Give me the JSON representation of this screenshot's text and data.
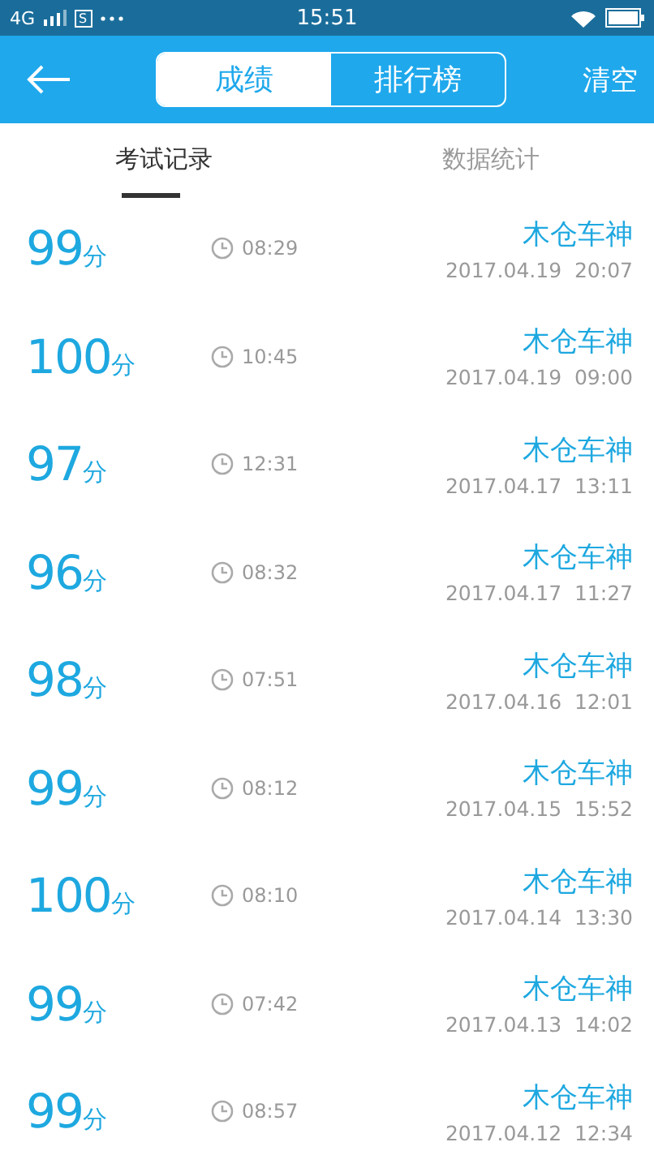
{
  "status_bar": {
    "network": "4G",
    "notification": "S",
    "time": "15:51"
  },
  "header": {
    "tabs": [
      {
        "label": "成绩",
        "selected": true
      },
      {
        "label": "排行榜",
        "selected": false
      }
    ],
    "action": "清空"
  },
  "sub_tabs": [
    {
      "label": "考试记录",
      "selected": true
    },
    {
      "label": "数据统计",
      "selected": false
    }
  ],
  "records": [
    {
      "score": "99",
      "unit": "分",
      "duration": "08:29",
      "name": "木仓车神",
      "date": "2017.04.19  20:07"
    },
    {
      "score": "100",
      "unit": "分",
      "duration": "10:45",
      "name": "木仓车神",
      "date": "2017.04.19  09:00"
    },
    {
      "score": "97",
      "unit": "分",
      "duration": "12:31",
      "name": "木仓车神",
      "date": "2017.04.17  13:11"
    },
    {
      "score": "96",
      "unit": "分",
      "duration": "08:32",
      "name": "木仓车神",
      "date": "2017.04.17  11:27"
    },
    {
      "score": "98",
      "unit": "分",
      "duration": "07:51",
      "name": "木仓车神",
      "date": "2017.04.16  12:01"
    },
    {
      "score": "99",
      "unit": "分",
      "duration": "08:12",
      "name": "木仓车神",
      "date": "2017.04.15  15:52"
    },
    {
      "score": "100",
      "unit": "分",
      "duration": "08:10",
      "name": "木仓车神",
      "date": "2017.04.14  13:30"
    },
    {
      "score": "99",
      "unit": "分",
      "duration": "07:42",
      "name": "木仓车神",
      "date": "2017.04.13  14:02"
    },
    {
      "score": "99",
      "unit": "分",
      "duration": "08:57",
      "name": "木仓车神",
      "date": "2017.04.12  12:34"
    }
  ]
}
